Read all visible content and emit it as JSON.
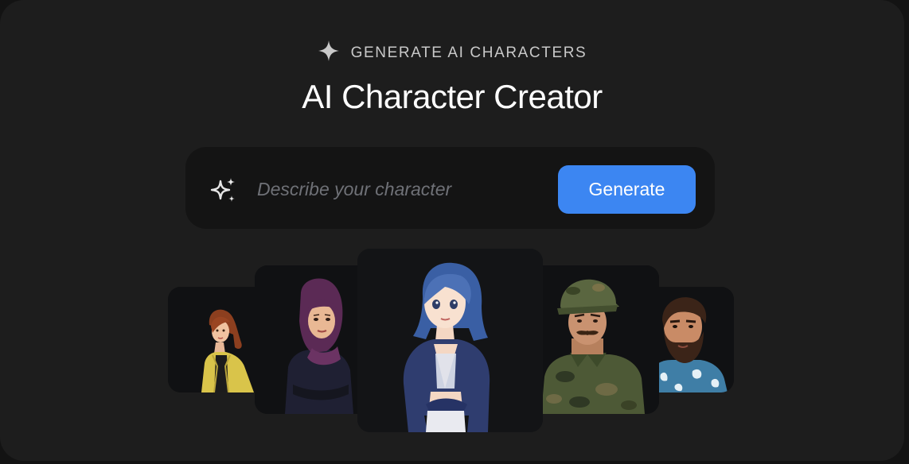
{
  "header": {
    "eyebrow_icon": "sparkle-icon",
    "eyebrow_label": "GENERATE AI CHARACTERS",
    "title": "AI Character Creator"
  },
  "prompt": {
    "icon": "sparkles-icon",
    "placeholder": "Describe your character",
    "value": "",
    "button_label": "Generate"
  },
  "colors": {
    "background": "#1d1d1d",
    "bar": "#141414",
    "accent": "#3c86f2",
    "text": "#ffffff"
  },
  "characters": [
    {
      "name": "red-haired-woman-yellow-jacket"
    },
    {
      "name": "woman-purple-hijab"
    },
    {
      "name": "blue-haired-girl"
    },
    {
      "name": "soldier-camouflage"
    },
    {
      "name": "bearded-man-hawaiian-shirt"
    }
  ]
}
